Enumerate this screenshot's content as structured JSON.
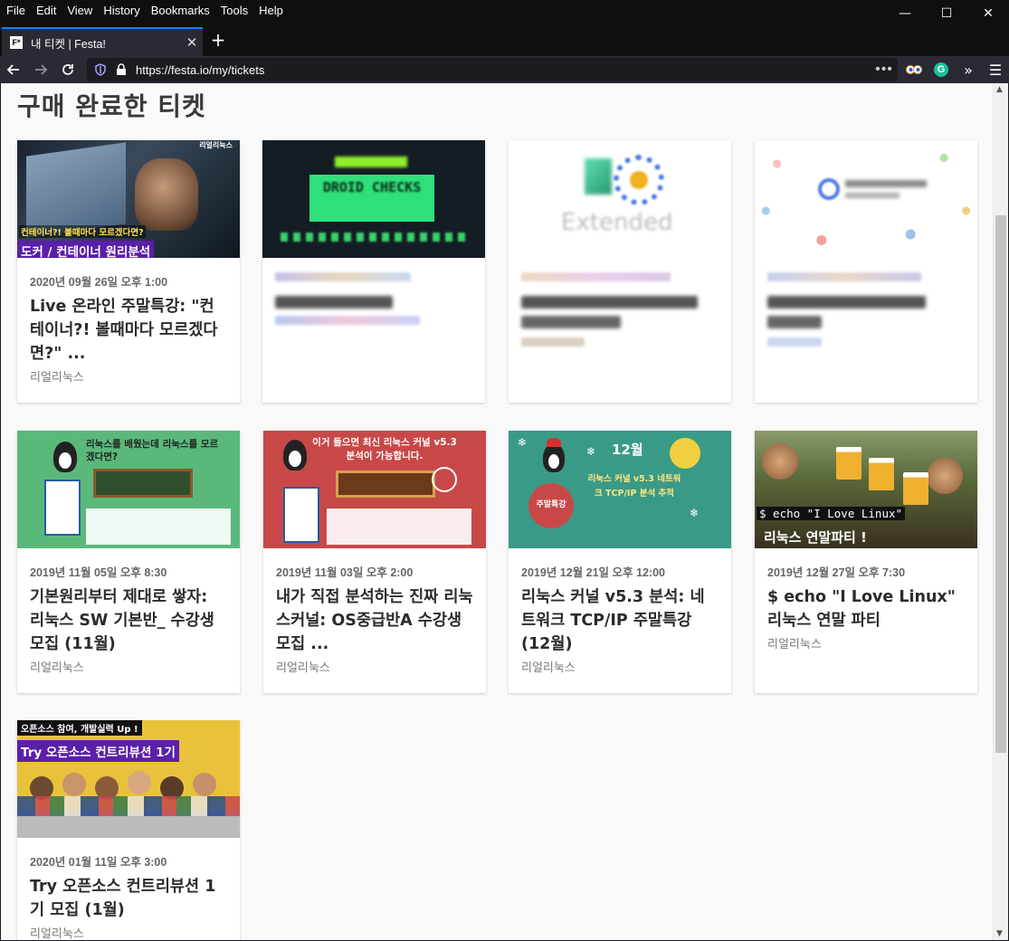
{
  "menu": [
    "File",
    "Edit",
    "View",
    "History",
    "Bookmarks",
    "Tools",
    "Help"
  ],
  "window_controls": [
    "—",
    "☐",
    "✕"
  ],
  "tab": {
    "title": "내 티켓 | Festa!",
    "favicon": "F*"
  },
  "url": "https://festa.io/my/tickets",
  "heading": "구매 완료한 티켓",
  "cards": [
    {
      "date": "2020년 09월 26일 오후 1:00",
      "title": "Live 온라인 주말특강: \"컨테이너?! 볼때마다 모르겠다면?\" ...",
      "host": "리얼리눅스",
      "banner_top": "컨테이너?! 볼때마다 모르겠다면?",
      "banner_main": "도커 / 컨테이너 원리분석",
      "badge": "리얼리눅스"
    },
    {
      "date": "",
      "title": "",
      "host": "",
      "banner_main": "DROID CHECKS"
    },
    {
      "date": "",
      "title": "",
      "host": "",
      "banner_main": "Extended"
    },
    {
      "date": "",
      "title": "",
      "host": ""
    },
    {
      "date": "2019년 11월 05일 오후 8:30",
      "title": "기본원리부터 제대로 쌓자: 리눅스 SW 기본반_ 수강생 모집 (11월)",
      "host": "리얼리눅스",
      "banner_main": "리눅스를 배웠는데 리눅스를 모르겠다면?"
    },
    {
      "date": "2019년 11월 03일 오후 2:00",
      "title": "내가 직접 분석하는 진짜 리눅스커널: OS중급반A 수강생 모집 ...",
      "host": "리얼리눅스",
      "banner_main": "이거 들으면 최신 리눅스 커널 v5.3 분석이 가능합니다."
    },
    {
      "date": "2019년 12월 21일 오후 12:00",
      "title": "리눅스 커널 v5.3 분석: 네트워크 TCP/IP 주말특강 (12월)",
      "host": "리얼리눅스",
      "banner_main": "12월",
      "banner_sub": "리눅스 커널 v5.3 네트워크 TCP/IP 분석 추적",
      "badge": "주말특강"
    },
    {
      "date": "2019년 12월 27일 오후 7:30",
      "title": "$ echo \"I Love Linux\" 리눅스 연말 파티",
      "host": "리얼리눅스",
      "banner_top": "$ echo \"I Love Linux\"",
      "banner_main": "리눅스 연말파티 !"
    },
    {
      "date": "2020년 01월 11일 오후 3:00",
      "title": "Try 오픈소스 컨트리뷰션 1기 모집 (1월)",
      "host": "리얼리눅스",
      "banner_top": "오픈소스 참여, 개발실력 Up !",
      "banner_main": "Try 오픈소스 컨트리뷰션 1기"
    }
  ],
  "colors": {
    "accent": "#0a84ff",
    "purple_banner": "#5b1fa8",
    "green_banner": "#5ab97a",
    "red_banner": "#c84848",
    "teal_banner": "#3a9a88",
    "yellow_banner": "#e8c23a"
  }
}
